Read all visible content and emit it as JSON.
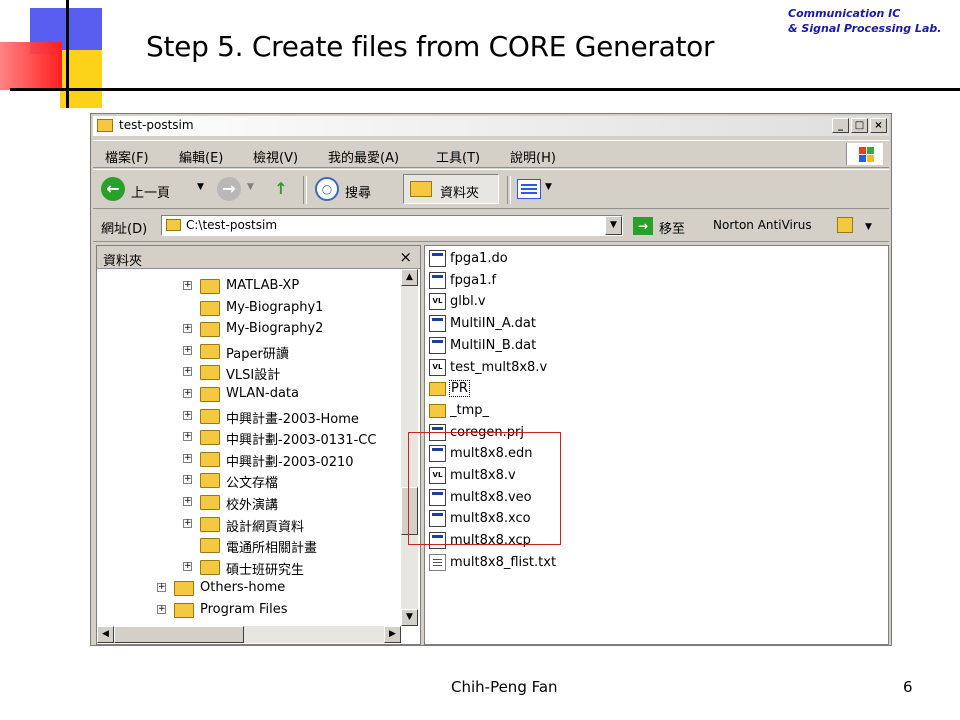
{
  "slide": {
    "title": "Step 5.   Create files from CORE Generator",
    "lab_line1": "Communication IC",
    "lab_line2": "& Signal Processing Lab.",
    "author": "Chih-Peng Fan",
    "page_number": "6"
  },
  "window": {
    "title": "test-postsim",
    "buttons": {
      "minimize": "_",
      "maximize": "□",
      "close": "×"
    }
  },
  "menubar": {
    "items": [
      "檔案(F)",
      "編輯(E)",
      "檢視(V)",
      "我的最愛(A)",
      "工具(T)",
      "說明(H)"
    ]
  },
  "toolbar": {
    "back_label": "上一頁",
    "search_label": "搜尋",
    "folders_label": "資料夾"
  },
  "address_bar": {
    "label": "網址(D)",
    "value": "C:\\test-postsim",
    "go_label": "移至",
    "norton_label": "Norton AntiVirus"
  },
  "folders_pane": {
    "title": "資料夾",
    "close": "×",
    "items": [
      {
        "label": "MATLAB-XP",
        "expander": "+"
      },
      {
        "label": "My-Biography1",
        "expander": ""
      },
      {
        "label": "My-Biography2",
        "expander": "+"
      },
      {
        "label": "Paper研讀",
        "expander": "+"
      },
      {
        "label": "VLSI設計",
        "expander": "+"
      },
      {
        "label": "WLAN-data",
        "expander": "+"
      },
      {
        "label": "中興計畫-2003-Home",
        "expander": "+"
      },
      {
        "label": "中興計劃-2003-0131-CC",
        "expander": "+"
      },
      {
        "label": "中興計劃-2003-0210",
        "expander": "+"
      },
      {
        "label": "公文存檔",
        "expander": "+"
      },
      {
        "label": "校外演講",
        "expander": "+"
      },
      {
        "label": "設計網頁資料",
        "expander": "+"
      },
      {
        "label": "電通所相關計畫",
        "expander": ""
      },
      {
        "label": "碩士班研究生",
        "expander": "+"
      },
      {
        "label": "Others-home",
        "expander": "+"
      },
      {
        "label": "Program Files",
        "expander": "+"
      }
    ]
  },
  "files_pane": {
    "files": [
      {
        "name": "fpga1.do",
        "icon": "doc-icon"
      },
      {
        "name": "fpga1.f",
        "icon": "doc-icon"
      },
      {
        "name": "glbl.v",
        "icon": "vl-icon"
      },
      {
        "name": "MultiIN_A.dat",
        "icon": "doc-icon"
      },
      {
        "name": "MultiIN_B.dat",
        "icon": "doc-icon"
      },
      {
        "name": "test_mult8x8.v",
        "icon": "vl-icon"
      },
      {
        "name": "PR",
        "icon": "folder-icon"
      },
      {
        "name": "_tmp_",
        "icon": "folder-icon"
      },
      {
        "name": "coregen.prj",
        "icon": "doc-icon"
      },
      {
        "name": "mult8x8.edn",
        "icon": "doc-icon"
      },
      {
        "name": "mult8x8.v",
        "icon": "vl-icon"
      },
      {
        "name": "mult8x8.veo",
        "icon": "doc-icon"
      },
      {
        "name": "mult8x8.xco",
        "icon": "doc-icon"
      },
      {
        "name": "mult8x8.xcp",
        "icon": "doc-icon"
      },
      {
        "name": "mult8x8_flist.txt",
        "icon": "txt-icon"
      }
    ],
    "vl_text": "VL"
  },
  "colors": {
    "highlight_box": "#cc2222",
    "lab_text": "#1a1aa8",
    "deco_blue": "#5a5ef0",
    "deco_yellow": "#ffd21a",
    "deco_red": "#ff2020"
  }
}
